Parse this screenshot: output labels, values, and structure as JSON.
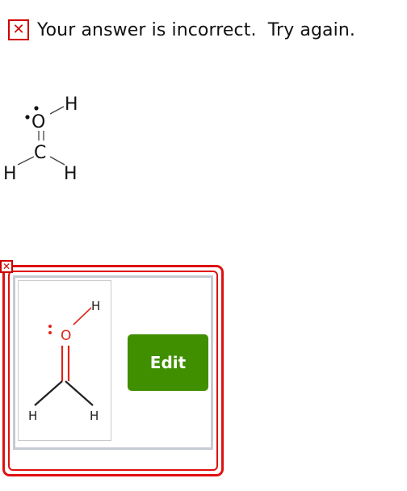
{
  "feedback": {
    "icon": "x-mark-icon",
    "text": "Your answer is incorrect.  Try again."
  },
  "submitted_structure": {
    "atoms": {
      "oxygen": "O",
      "carbon": "C",
      "h_top": "H",
      "h_left": "H",
      "h_right": "H"
    }
  },
  "answer_panel": {
    "error_icon": "x-mark-icon",
    "atoms": {
      "oxygen": "O",
      "h_top": "H",
      "h_left": "H",
      "h_right": "H"
    },
    "edit_label": "Edit"
  },
  "colors": {
    "error_red": "#d10000",
    "button_green": "#3f8f00",
    "panel_border_gray": "#c5cbd3",
    "oxygen_red": "#e0241b"
  }
}
